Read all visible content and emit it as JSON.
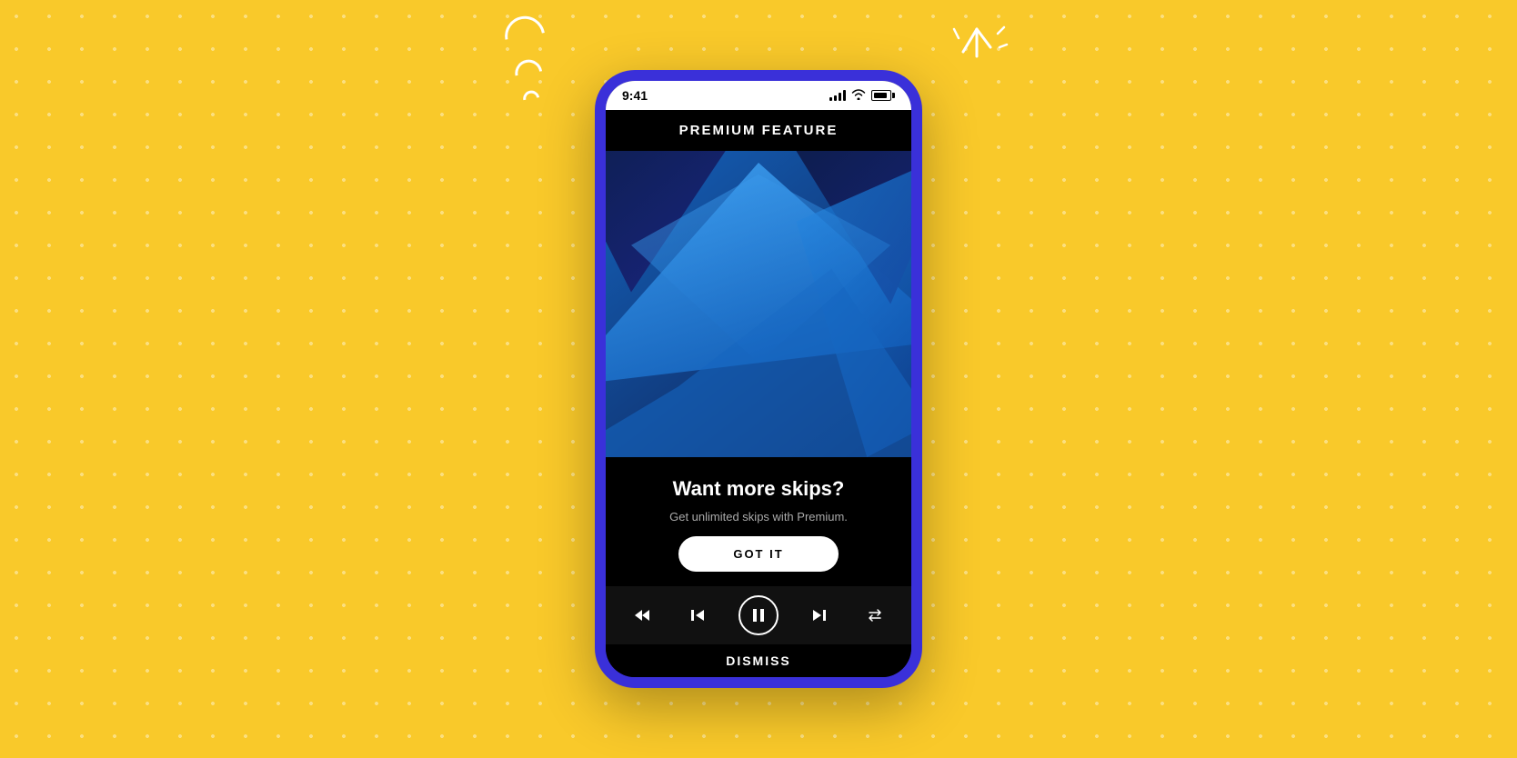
{
  "background": {
    "color": "#F9C92A"
  },
  "phone": {
    "frame_color": "#3A30D9",
    "status_bar": {
      "time": "9:41",
      "signal_label": "signal",
      "wifi_label": "wifi",
      "battery_label": "battery"
    },
    "premium_label": "PREMIUM FEATURE",
    "graphic": {
      "description": "Abstract blue geometric shapes"
    },
    "content": {
      "title": "Want more skips?",
      "subtitle": "Get unlimited skips with Premium.",
      "cta_label": "GOT IT"
    },
    "player": {
      "rewind_label": "rewind",
      "skip_back_label": "skip back",
      "play_label": "play/pause",
      "skip_forward_label": "skip forward",
      "repeat_label": "repeat"
    },
    "dismiss_label": "DISMISS"
  },
  "decorations": {
    "wifi_signal": "wifi signal decoration left",
    "sparkle": "sparkle decoration right"
  }
}
